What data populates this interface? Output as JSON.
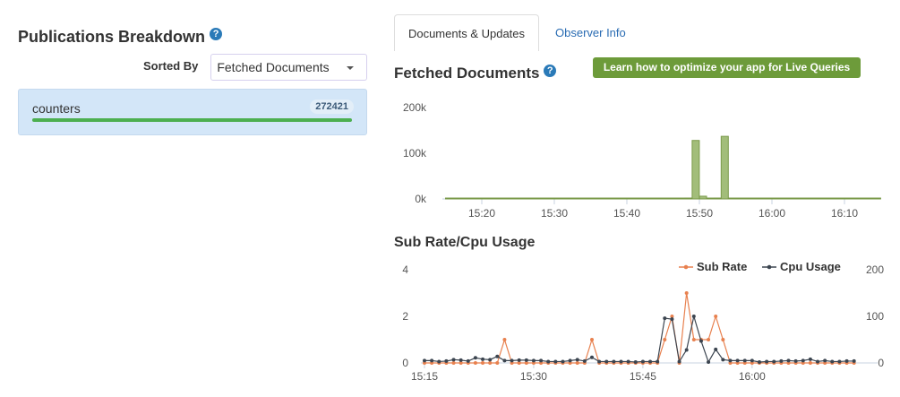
{
  "left": {
    "title": "Publications Breakdown",
    "help_icon": "?",
    "sorted_by_label": "Sorted By",
    "sort_value": "Fetched Documents",
    "publications": [
      {
        "name": "counters",
        "count": "272421",
        "fill_fraction": 1.0
      }
    ]
  },
  "tabs": [
    {
      "label": "Documents & Updates",
      "active": true
    },
    {
      "label": "Observer Info",
      "active": false
    }
  ],
  "fetched": {
    "title": "Fetched Documents",
    "learn_button": "Learn how to optimize your app for Live Queries"
  },
  "subrate": {
    "title": "Sub Rate/Cpu Usage"
  },
  "colors": {
    "bar": "#a2bd7a",
    "bar_stroke": "#7a9a4a",
    "sub": "#e8814f",
    "cpu": "#3c4550"
  },
  "chart_data": [
    {
      "type": "bar",
      "title": "Fetched Documents",
      "ylabel": "",
      "ylim": [
        0,
        200000
      ],
      "y_ticks": [
        "0k",
        "100k",
        "200k"
      ],
      "x_ticks": [
        "15:20",
        "15:30",
        "15:40",
        "15:50",
        "16:00",
        "16:10"
      ],
      "x_start": "15:15",
      "x_end": "16:14",
      "interval_minutes": 1,
      "points": [
        {
          "minute": "15:48",
          "value": 2000
        },
        {
          "minute": "15:49",
          "value": 128000
        },
        {
          "minute": "15:50",
          "value": 6000
        },
        {
          "minute": "15:52",
          "value": 2000
        },
        {
          "minute": "15:53",
          "value": 137000
        }
      ]
    },
    {
      "type": "line",
      "title": "Sub Rate/Cpu Usage",
      "x_start": "15:15",
      "interval_minutes": 1,
      "x_ticks": [
        "15:15",
        "15:30",
        "15:45",
        "16:00"
      ],
      "y_left_ticks": [
        "0",
        "2",
        "4"
      ],
      "y_right_ticks": [
        "0",
        "100",
        "200"
      ],
      "ylim_left": [
        0,
        4
      ],
      "ylim_right": [
        0,
        200
      ],
      "legend": "top-right",
      "series": [
        {
          "name": "Sub Rate",
          "axis": "left",
          "values": [
            0,
            0,
            0,
            0,
            0,
            0,
            0,
            0,
            0,
            0,
            0,
            1,
            0,
            0,
            0,
            0,
            0,
            0,
            0,
            0,
            0,
            0,
            0,
            1,
            0,
            0,
            0,
            0,
            0,
            0,
            0,
            0,
            0,
            1,
            2,
            0,
            3,
            1,
            1,
            1,
            2,
            1,
            0,
            0,
            0,
            0,
            0,
            0,
            0,
            0,
            0,
            0,
            0,
            0,
            0,
            0,
            0,
            0,
            0,
            0
          ]
        },
        {
          "name": "Cpu Usage",
          "axis": "right",
          "values": [
            5,
            5,
            3,
            4,
            7,
            6,
            4,
            11,
            8,
            7,
            14,
            5,
            5,
            6,
            6,
            5,
            5,
            3,
            3,
            3,
            5,
            7,
            4,
            12,
            3,
            3,
            3,
            3,
            3,
            2,
            3,
            3,
            3,
            96,
            94,
            3,
            28,
            100,
            47,
            2,
            29,
            7,
            5,
            5,
            5,
            5,
            2,
            3,
            3,
            4,
            5,
            4,
            5,
            8,
            3,
            5,
            3,
            3,
            4,
            4,
            3
          ]
        }
      ]
    }
  ]
}
